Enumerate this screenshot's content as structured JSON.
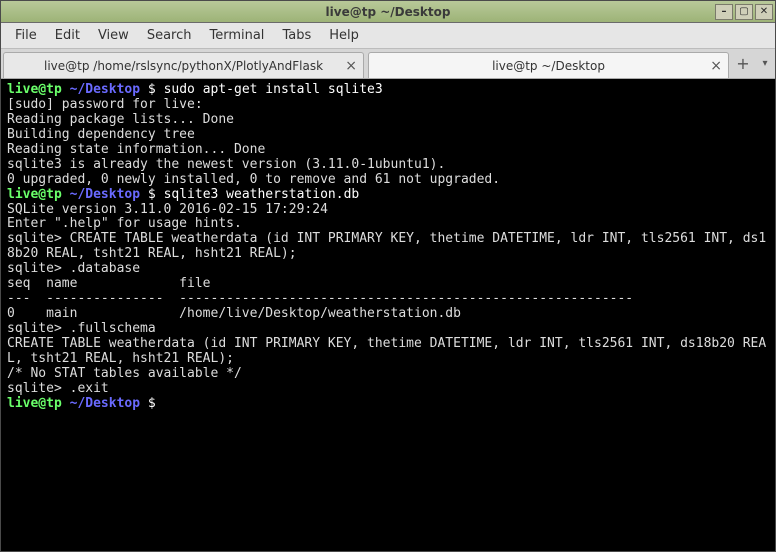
{
  "window": {
    "title": "live@tp ~/Desktop"
  },
  "menu": {
    "file": "File",
    "edit": "Edit",
    "view": "View",
    "search": "Search",
    "terminal": "Terminal",
    "tabs": "Tabs",
    "help": "Help"
  },
  "tabs": {
    "tab1": "live@tp /home/rslsync/pythonX/PlotlyAndFlask",
    "tab2": "live@tp ~/Desktop"
  },
  "prompt": {
    "user": "live@tp",
    "path": "~/Desktop",
    "symbol": "$"
  },
  "term": {
    "cmd1": "sudo apt-get install sqlite3",
    "out1": "[sudo] password for live:\nReading package lists... Done\nBuilding dependency tree\nReading state information... Done\nsqlite3 is already the newest version (3.11.0-1ubuntu1).\n0 upgraded, 0 newly installed, 0 to remove and 61 not upgraded.",
    "cmd2": "sqlite3 weatherstation.db",
    "out2": "SQLite version 3.11.0 2016-02-15 17:29:24\nEnter \".help\" for usage hints.\nsqlite> CREATE TABLE weatherdata (id INT PRIMARY KEY, thetime DATETIME, ldr INT, tls2561 INT, ds18b20 REAL, tsht21 REAL, hsht21 REAL);\nsqlite> .database\nseq  name             file\n---  ---------------  ----------------------------------------------------------\n0    main             /home/live/Desktop/weatherstation.db\nsqlite> .fullschema\nCREATE TABLE weatherdata (id INT PRIMARY KEY, thetime DATETIME, ldr INT, tls2561 INT, ds18b20 REAL, tsht21 REAL, hsht21 REAL);\n/* No STAT tables available */\nsqlite> .exit"
  }
}
